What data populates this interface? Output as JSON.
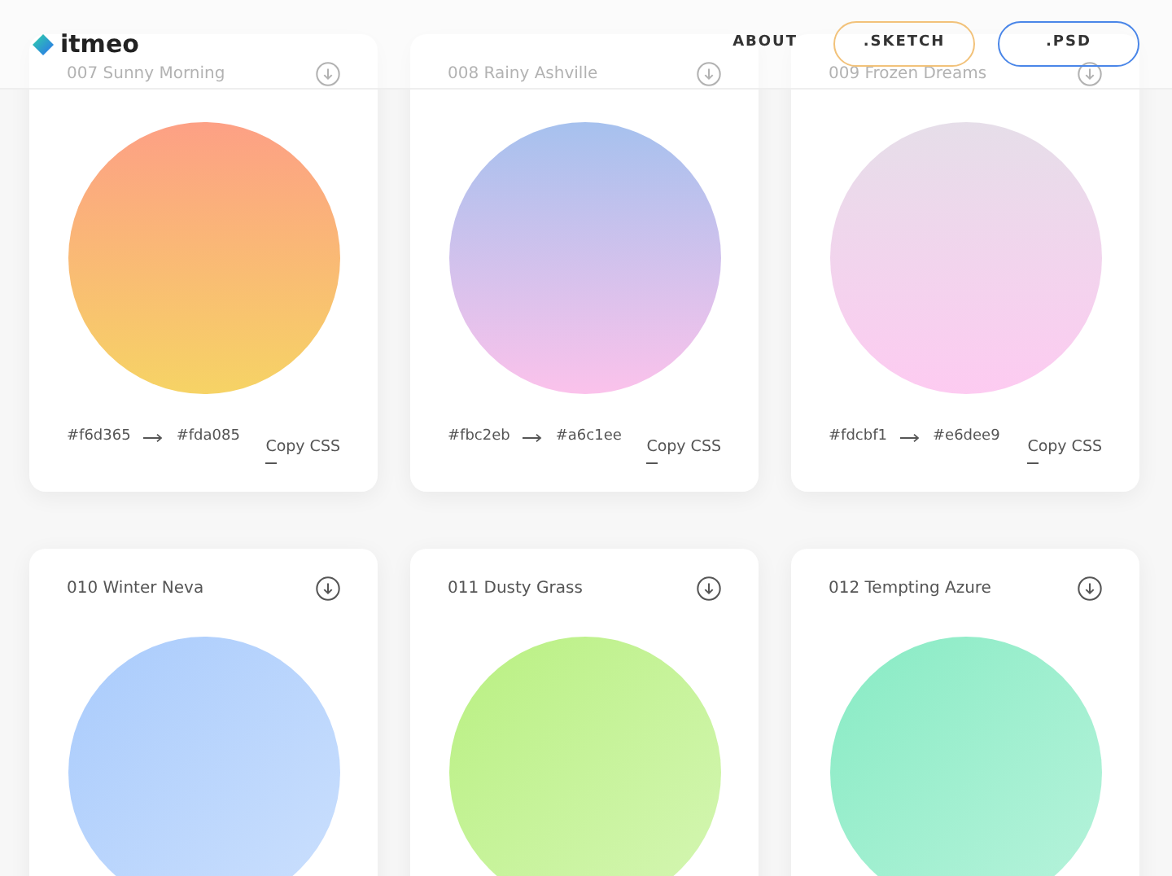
{
  "header": {
    "logo": "itmeo",
    "nav": [
      {
        "label": "ABOUT",
        "kind": "link"
      },
      {
        "label": ".SKETCH",
        "kind": "outline-orange"
      },
      {
        "label": ".PSD",
        "kind": "outline-blue"
      }
    ]
  },
  "gradients": [
    {
      "title": "007 Sunny Morning",
      "from": "#f6d365",
      "to": "#fda085",
      "action": "Copy CSS"
    },
    {
      "title": "008 Rainy Ashville",
      "from": "#fbc2eb",
      "to": "#a6c1ee",
      "action": "Copy CSS"
    },
    {
      "title": "009 Frozen Dreams",
      "from": "#fdcbf1",
      "to": "#e6dee9",
      "action": "Copy CSS"
    },
    {
      "title": "010 Winter Neva",
      "color": "#a9cbfc"
    },
    {
      "title": "011 Dusty Grass",
      "color": "#b9f081"
    },
    {
      "title": "012 Tempting Azure",
      "color": "#87ebc4"
    }
  ]
}
